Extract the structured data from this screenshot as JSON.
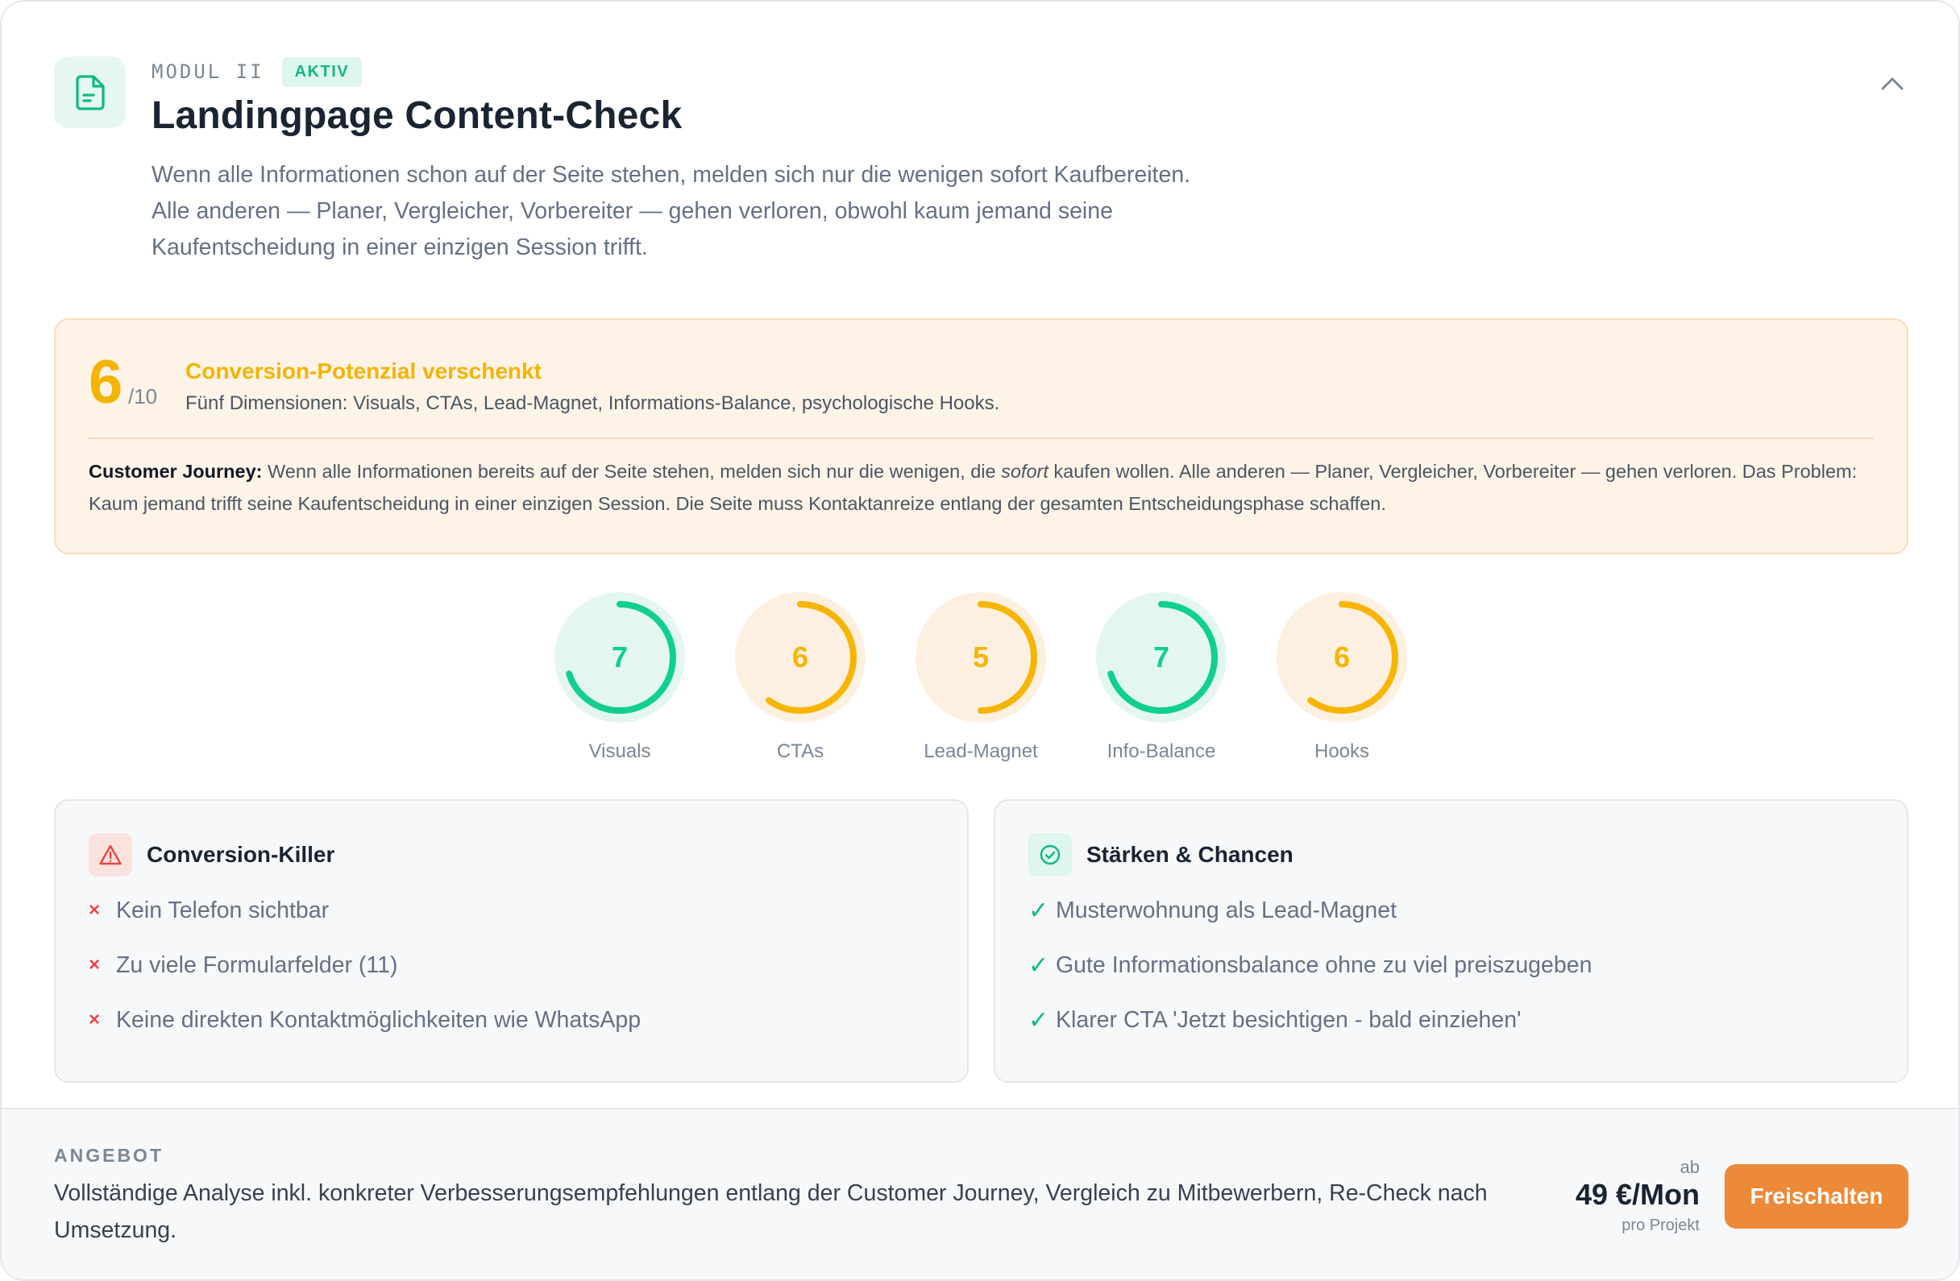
{
  "header": {
    "icon": "document-icon",
    "module": "MODUL II",
    "status_badge": "AKTIV",
    "title": "Landingpage Content-Check",
    "intro": "Wenn alle Informationen schon auf der Seite stehen, melden sich nur die wenigen sofort Kaufbereiten. Alle anderen — Planer, Vergleicher, Vorbereiter — gehen verloren, obwohl kaum jemand seine Kaufentscheidung in einer einzigen Session trifft.",
    "collapse_icon": "chevron-up-icon"
  },
  "score": {
    "value": "6",
    "max": "/10",
    "heading": "Conversion-Potenzial verschenkt",
    "subtitle": "Fünf Dimensionen: Visuals, CTAs, Lead-Magnet, Informations-Balance, psychologische Hooks.",
    "journey_label": "Customer Journey:",
    "journey_text_1": "Wenn alle Informationen bereits auf der Seite stehen, melden sich nur die wenigen, die",
    "journey_emphasis": "sofort",
    "journey_text_2": "kaufen wollen. Alle anderen — Planer, Vergleicher, Vorbereiter — gehen verloren. Das Problem: Kaum jemand trifft seine Kaufentscheidung in einer einzigen Session. Die Seite muss Kontaktanreize entlang der gesamten Entscheidungsphase schaffen."
  },
  "gauges": [
    {
      "label": "Visuals",
      "value": 7,
      "max": 10,
      "color": "#10cf8f",
      "bg": "#e4f7ef"
    },
    {
      "label": "CTAs",
      "value": 6,
      "max": 10,
      "color": "#f7b500",
      "bg": "#fdf0e0"
    },
    {
      "label": "Lead-Magnet",
      "value": 5,
      "max": 10,
      "color": "#f7b500",
      "bg": "#fdf0e0"
    },
    {
      "label": "Info-Balance",
      "value": 7,
      "max": 10,
      "color": "#10cf8f",
      "bg": "#e4f7ef"
    },
    {
      "label": "Hooks",
      "value": 6,
      "max": 10,
      "color": "#f7b500",
      "bg": "#fdf0e0"
    }
  ],
  "killers": {
    "title": "Conversion-Killer",
    "icon": "warning-triangle-icon",
    "mark": "×",
    "items": [
      "Kein Telefon sichtbar",
      "Zu viele Formularfelder (11)",
      "Keine direkten Kontaktmöglichkeiten wie WhatsApp"
    ]
  },
  "strengths": {
    "title": "Stärken & Chancen",
    "icon": "check-circle-icon",
    "mark": "✓",
    "items": [
      "Musterwohnung als Lead-Magnet",
      "Gute Informationsbalance ohne zu viel preiszugeben",
      "Klarer CTA 'Jetzt besichtigen - bald einziehen'"
    ]
  },
  "offer": {
    "label": "ANGEBOT",
    "text": "Vollständige Analyse inkl. konkreter Verbesserungsempfehlungen entlang der Customer Journey, Vergleich zu Mitbewerbern, Re-Check nach Umsetzung.",
    "price_prefix": "ab",
    "price": "49 €/Mon",
    "price_unit": "pro Projekt",
    "button": "Freischalten"
  },
  "colors": {
    "green": "#10b981",
    "amber": "#f5b400",
    "orange_button": "#ec8a3a",
    "red": "#ef4444"
  }
}
